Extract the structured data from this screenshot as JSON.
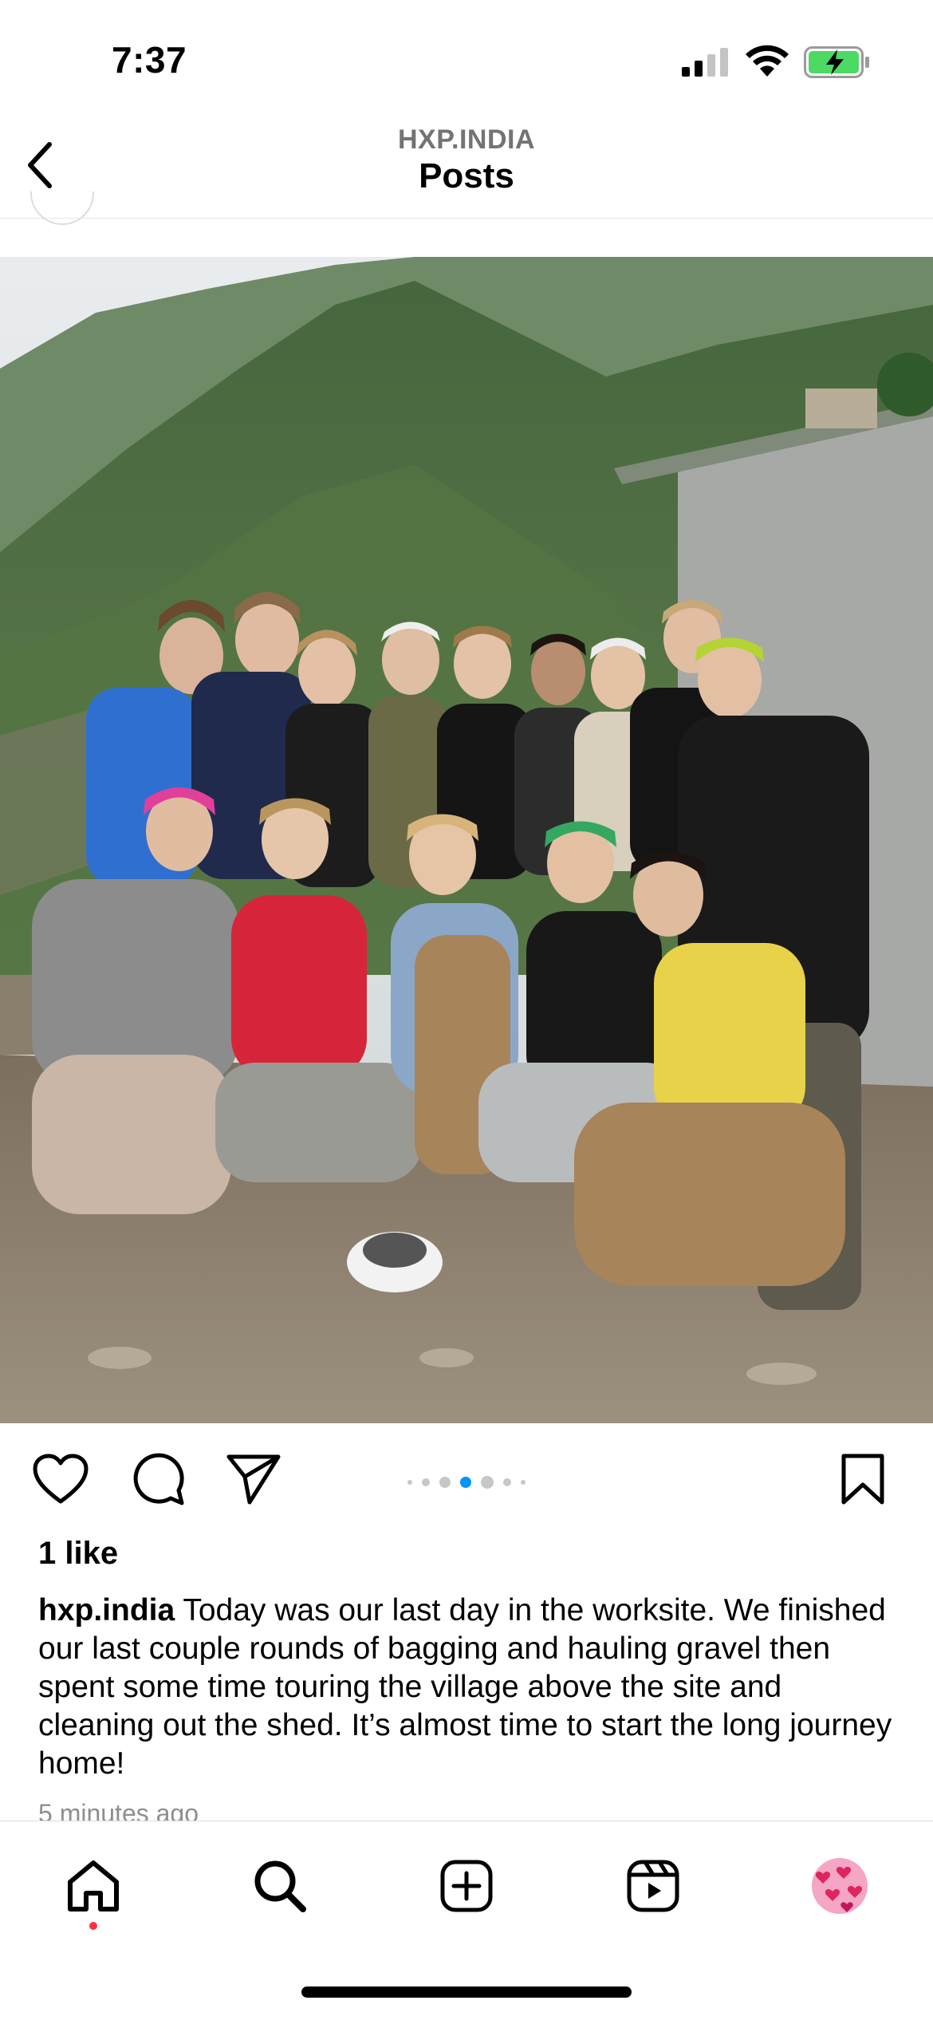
{
  "status_bar": {
    "time": "7:37",
    "battery_charging": true,
    "battery_color": "#4cd964"
  },
  "nav": {
    "username": "HXP.INDIA",
    "title": "Posts"
  },
  "post": {
    "image_icon": "photo-group-on-mountain",
    "carousel": {
      "total": 7,
      "active_index": 4
    },
    "likes": "1 like",
    "caption_user": "hxp.india",
    "caption_text": " Today was our last day in the worksite. We finished our last couple rounds of bagging and hauling gravel then spent some time touring the village above the site and cleaning out the shed. It’s almost time to start the long journey home!",
    "timestamp": "5 minutes ago"
  },
  "actions": {
    "like_icon": "heart-icon",
    "comment_icon": "comment-icon",
    "share_icon": "send-icon",
    "save_icon": "bookmark-icon",
    "active_dot_color": "#0095f6"
  },
  "tab_bar": {
    "items": [
      "home-icon",
      "search-icon",
      "create-icon",
      "reels-icon",
      "profile-icon"
    ],
    "notification_color": "#ff3040"
  }
}
